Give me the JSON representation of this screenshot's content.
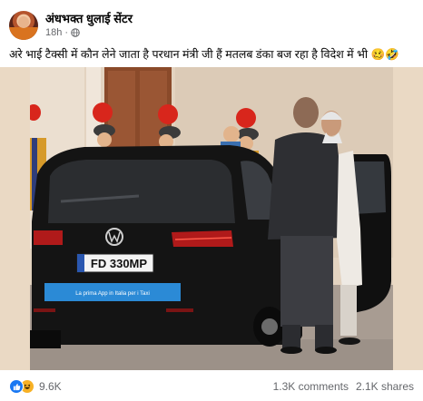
{
  "post": {
    "page_name": "अंधभक्त धुलाई सेंटर",
    "time": "18h",
    "caption": "अरे भाई टैक्सी में कौन लेने जाता है परधान मंत्री जी हैं मतलब डंका बज रहा है विदेश में भी 🥴🤣",
    "photo": {
      "license_plate": "FD 330MP",
      "car_banner": "La prima App in Italia per i Taxi"
    },
    "reactions_count": "9.6K",
    "comments": "1.3K comments",
    "shares": "2.1K shares"
  },
  "icons": {
    "privacy": "globe-icon",
    "reactions": [
      "like-icon",
      "haha-icon"
    ]
  },
  "colors": {
    "like_blue": "#1877f2",
    "haha_yellow": "#f7b125",
    "secondary_text": "#65676b",
    "banner_blue": "#2b8ad6"
  }
}
